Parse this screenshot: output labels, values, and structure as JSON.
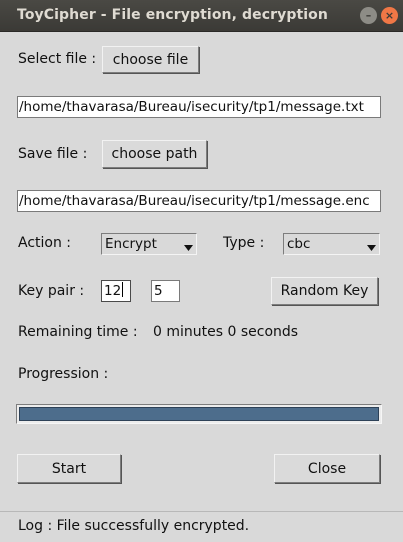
{
  "window": {
    "title": "ToyCipher - File encryption, decryption",
    "minimize_glyph": "–",
    "close_glyph": "×"
  },
  "select_file": {
    "label": "Select file :",
    "button_label": "choose file",
    "path_value": "/home/thavarasa/Bureau/isecurity/tp1/message.txt"
  },
  "save_file": {
    "label": "Save file :",
    "button_label": "choose path",
    "path_value": "/home/thavarasa/Bureau/isecurity/tp1/message.enc"
  },
  "action": {
    "label": "Action :",
    "selected": "Encrypt"
  },
  "type": {
    "label": "Type :",
    "selected": "cbc"
  },
  "key_pair": {
    "label": "Key pair :",
    "key1": "12",
    "key2": "5",
    "random_label": "Random Key"
  },
  "remaining": {
    "label": "Remaining time :",
    "value": "0 minutes  0 seconds"
  },
  "progression": {
    "label": "Progression :",
    "percent": 100
  },
  "buttons": {
    "start_label": "Start",
    "close_label": "Close"
  },
  "log": {
    "text": "Log : File successfully encrypted."
  },
  "colors": {
    "progress_fill": "#4d6d8c",
    "close_button": "#f07746",
    "titlebar": "#3b3a36"
  }
}
